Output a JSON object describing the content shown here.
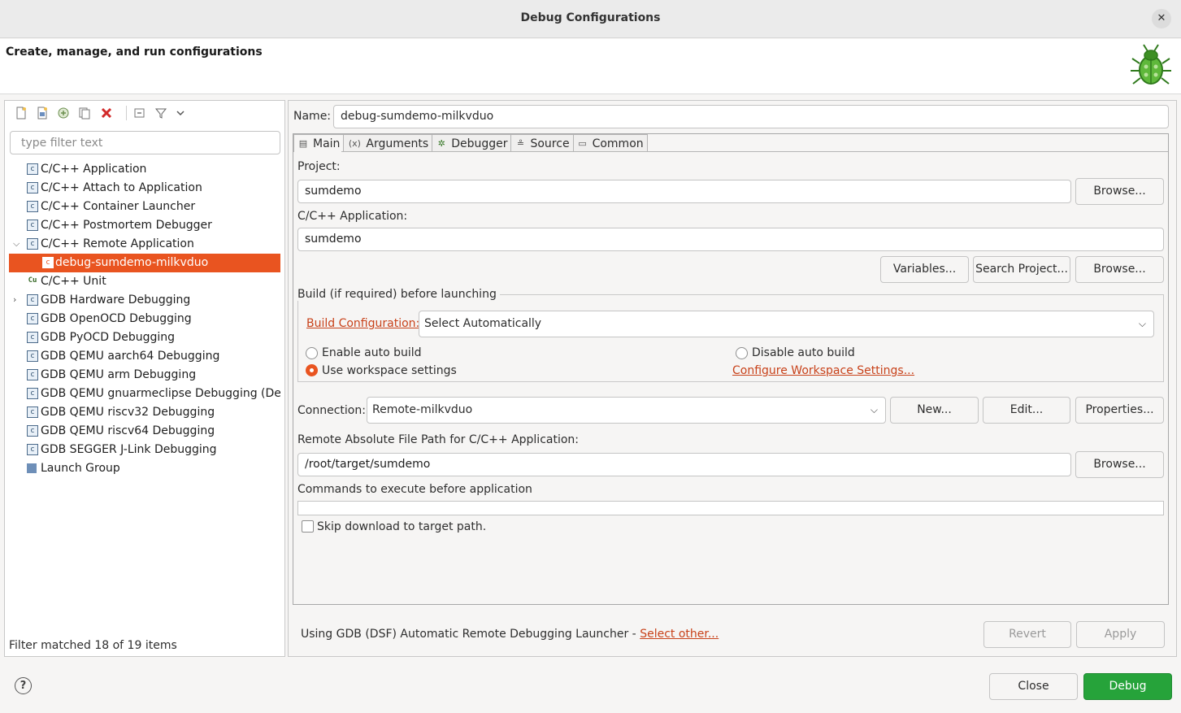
{
  "window": {
    "title": "Debug Configurations",
    "close_glyph": "✕"
  },
  "header": {
    "heading": "Create, manage, and run configurations",
    "icon": "bug-icon"
  },
  "left": {
    "filter_placeholder": "type filter text",
    "tree": [
      {
        "label": "C/C++ Application",
        "icon": "c-config-icon"
      },
      {
        "label": "C/C++ Attach to Application",
        "icon": "c-config-icon"
      },
      {
        "label": "C/C++ Container Launcher",
        "icon": "c-config-icon"
      },
      {
        "label": "C/C++ Postmortem Debugger",
        "icon": "c-config-icon"
      },
      {
        "label": "C/C++ Remote Application",
        "icon": "c-config-icon",
        "expanded": true
      },
      {
        "label": "debug-sumdemo-milkvduo",
        "icon": "c-config-icon",
        "selected": true,
        "child": true
      },
      {
        "label": "C/C++ Unit",
        "icon": "c-unit-icon"
      },
      {
        "label": "GDB Hardware Debugging",
        "icon": "c-config-icon",
        "collapsed": true
      },
      {
        "label": "GDB OpenOCD Debugging",
        "icon": "c-config-icon"
      },
      {
        "label": "GDB PyOCD Debugging",
        "icon": "c-config-icon"
      },
      {
        "label": "GDB QEMU aarch64 Debugging",
        "icon": "c-config-icon"
      },
      {
        "label": "GDB QEMU arm Debugging",
        "icon": "c-config-icon"
      },
      {
        "label": "GDB QEMU gnuarmeclipse Debugging (Depre",
        "icon": "c-config-icon"
      },
      {
        "label": "GDB QEMU riscv32 Debugging",
        "icon": "c-config-icon"
      },
      {
        "label": "GDB QEMU riscv64 Debugging",
        "icon": "c-config-icon"
      },
      {
        "label": "GDB SEGGER J-Link Debugging",
        "icon": "c-config-icon"
      },
      {
        "label": "Launch Group",
        "icon": "launch-group-icon"
      }
    ],
    "status": "Filter matched 18 of 19 items"
  },
  "right": {
    "name_label": "Name:",
    "name_value": "debug-sumdemo-milkvduo",
    "tabs": [
      {
        "label": "Main",
        "icon": "main-tab-icon",
        "glyph": "▤",
        "active": true
      },
      {
        "label": "Arguments",
        "icon": "arguments-tab-icon",
        "glyph": "(x)"
      },
      {
        "label": "Debugger",
        "icon": "debugger-tab-icon",
        "glyph": "✲"
      },
      {
        "label": "Source",
        "icon": "source-tab-icon",
        "glyph": "≗"
      },
      {
        "label": "Common",
        "icon": "common-tab-icon",
        "glyph": "▭"
      }
    ],
    "main": {
      "project_label": "Project:",
      "project_value": "sumdemo",
      "browse_label": "Browse...",
      "app_label": "C/C++ Application:",
      "app_value": "sumdemo",
      "variables_label": "Variables...",
      "search_project_label": "Search Project...",
      "build_group_label": "Build (if required) before launching",
      "build_config_link": "Build Configuration:",
      "build_config_value": "Select Automatically",
      "enable_auto_build": "Enable auto build",
      "disable_auto_build": "Disable auto build",
      "use_workspace_settings": "Use workspace settings",
      "configure_workspace_link": "Configure Workspace Settings...",
      "selected_build_option": "Use workspace settings",
      "connection_label": "Connection:",
      "connection_value": "Remote-milkvduo",
      "new_label": "New...",
      "edit_label": "Edit...",
      "properties_label": "Properties...",
      "remote_path_label": "Remote Absolute File Path for C/C++ Application:",
      "remote_path_value": "/root/target/sumdemo",
      "commands_label": "Commands to execute before application",
      "commands_value": "",
      "skip_download_label": "Skip download to target path.",
      "skip_download_checked": false
    },
    "launcher_text": "Using GDB (DSF) Automatic Remote Debugging Launcher - ",
    "launcher_link": "Select other...",
    "revert_label": "Revert",
    "apply_label": "Apply"
  },
  "footer": {
    "help_glyph": "?",
    "close_label": "Close",
    "debug_label": "Debug"
  },
  "colors": {
    "accent": "#e95420",
    "link": "#c8421a",
    "debug_green": "#26a33a"
  }
}
